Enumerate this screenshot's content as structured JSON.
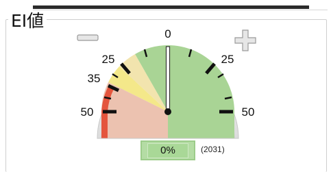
{
  "panel": {
    "title": "EI値"
  },
  "gauge": {
    "value_percent": 0,
    "needle_value": 0,
    "scale_range": [
      -50,
      50
    ],
    "tick_labels": {
      "center": "0",
      "left_25": "25",
      "left_35": "35",
      "left_50": "50",
      "right_25": "25",
      "right_50": "50"
    },
    "zones": [
      {
        "name": "green",
        "color": "#a9d495"
      },
      {
        "name": "pale-yellow",
        "color": "#f2e4ae"
      },
      {
        "name": "yellow",
        "color": "#f4e88a"
      },
      {
        "name": "pink",
        "color": "#ecc2b0"
      },
      {
        "name": "red",
        "color": "#e4553d"
      }
    ],
    "icons": {
      "zoom_out": "minus-icon",
      "zoom_in": "plus-icon"
    }
  },
  "readout": {
    "percent": "0%",
    "count": "(2031)"
  }
}
